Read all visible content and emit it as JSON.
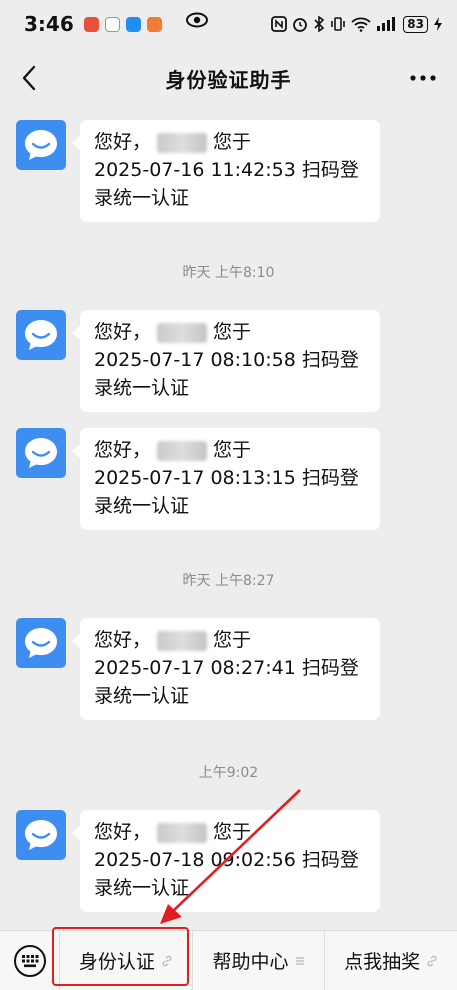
{
  "status": {
    "time": "3:46",
    "battery": "83"
  },
  "header": {
    "title": "身份验证助手"
  },
  "messages": [
    {
      "greeting": "您好，",
      "after": "您于",
      "line2": "2025-07-16 11:42:53 扫码登",
      "line3": "录统一认证"
    },
    {
      "greeting": "您好，",
      "after": "您于",
      "line2": "2025-07-17 08:10:58 扫码登",
      "line3": "录统一认证"
    },
    {
      "greeting": "您好，",
      "after": "您于",
      "line2": "2025-07-17 08:13:15 扫码登",
      "line3": "录统一认证"
    },
    {
      "greeting": "您好，",
      "after": "您于",
      "line2": "2025-07-17 08:27:41 扫码登",
      "line3": "录统一认证"
    },
    {
      "greeting": "您好，",
      "after": "您于",
      "line2": "2025-07-18 09:02:56 扫码登",
      "line3": "录统一认证"
    }
  ],
  "timestamps": [
    "昨天 上午8:10",
    "昨天 上午8:27",
    "上午9:02"
  ],
  "menu": {
    "items": [
      {
        "label": "身份认证",
        "mark": "link-icon"
      },
      {
        "label": "帮助中心",
        "mark": "menu-lines-icon"
      },
      {
        "label": "点我抽奖",
        "mark": "link-icon"
      }
    ]
  },
  "colors": {
    "avatar": "#3d8ef0",
    "highlight": "#e02020",
    "background": "#ededed"
  }
}
